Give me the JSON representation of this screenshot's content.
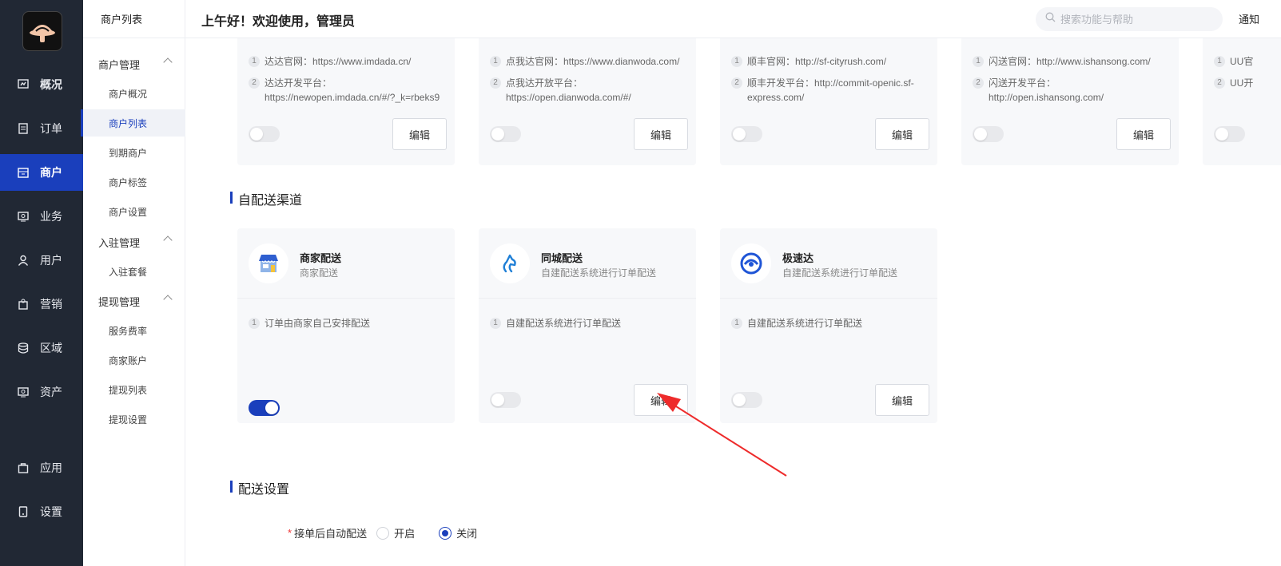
{
  "sidebar": {
    "items": [
      {
        "label": "概况",
        "icon": "overview-icon"
      },
      {
        "label": "订单",
        "icon": "order-icon"
      },
      {
        "label": "商户",
        "icon": "merchant-icon"
      },
      {
        "label": "业务",
        "icon": "business-icon"
      },
      {
        "label": "用户",
        "icon": "user-icon"
      },
      {
        "label": "营销",
        "icon": "marketing-icon"
      },
      {
        "label": "区域",
        "icon": "region-icon"
      },
      {
        "label": "资产",
        "icon": "asset-icon"
      },
      {
        "label": "应用",
        "icon": "app-icon"
      },
      {
        "label": "设置",
        "icon": "settings-icon"
      }
    ],
    "active": "商户",
    "accent_color": "#1a3fbc"
  },
  "submenu": {
    "title": "商户列表",
    "groups": [
      {
        "label": "商户管理",
        "items": [
          "商户概况",
          "商户列表",
          "到期商户",
          "商户标签",
          "商户设置"
        ]
      },
      {
        "label": "入驻管理",
        "items": [
          "入驻套餐"
        ]
      },
      {
        "label": "提现管理",
        "items": [
          "服务费率",
          "商家账户",
          "提现列表",
          "提现设置"
        ]
      }
    ],
    "active": "商户列表"
  },
  "header": {
    "greeting": "上午好！欢迎使用，管理员",
    "search_placeholder": "搜索功能与帮助",
    "right_text": "通知"
  },
  "third_party_cards": [
    {
      "lines": [
        "达达官网：https://www.imdada.cn/",
        "达达开发平台：https://newopen.imdada.cn/#/?_k=rbeks9"
      ],
      "enabled": false,
      "button": "编辑"
    },
    {
      "lines": [
        "点我达官网：https://www.dianwoda.com/",
        "点我达开放平台：https://open.dianwoda.com/#/"
      ],
      "enabled": false,
      "button": "编辑"
    },
    {
      "lines": [
        "顺丰官网：http://sf-cityrush.com/",
        "顺丰开发平台：http://commit-openic.sf-express.com/"
      ],
      "enabled": false,
      "button": "编辑"
    },
    {
      "lines": [
        "闪送官网：http://www.ishansong.com/",
        "闪送开发平台：http://open.ishansong.com/"
      ],
      "enabled": false,
      "button": "编辑"
    },
    {
      "lines": [
        "UU官",
        "UU开"
      ],
      "enabled": false
    }
  ],
  "self_delivery": {
    "title": "自配送渠道",
    "cards": [
      {
        "name": "商家配送",
        "desc": "商家配送",
        "line": "订单由商家自己安排配送",
        "enabled": true,
        "button": null
      },
      {
        "name": "同城配送",
        "desc": "自建配送系统进行订单配送",
        "line": "自建配送系统进行订单配送",
        "enabled": false,
        "button": "编辑"
      },
      {
        "name": "极速达",
        "desc": "自建配送系统进行订单配送",
        "line": "自建配送系统进行订单配送",
        "enabled": false,
        "button": "编辑"
      }
    ]
  },
  "delivery_settings": {
    "title": "配送设置",
    "field_label": "接单后自动配送",
    "options": [
      "开启",
      "关闭"
    ],
    "selected": "关闭"
  }
}
